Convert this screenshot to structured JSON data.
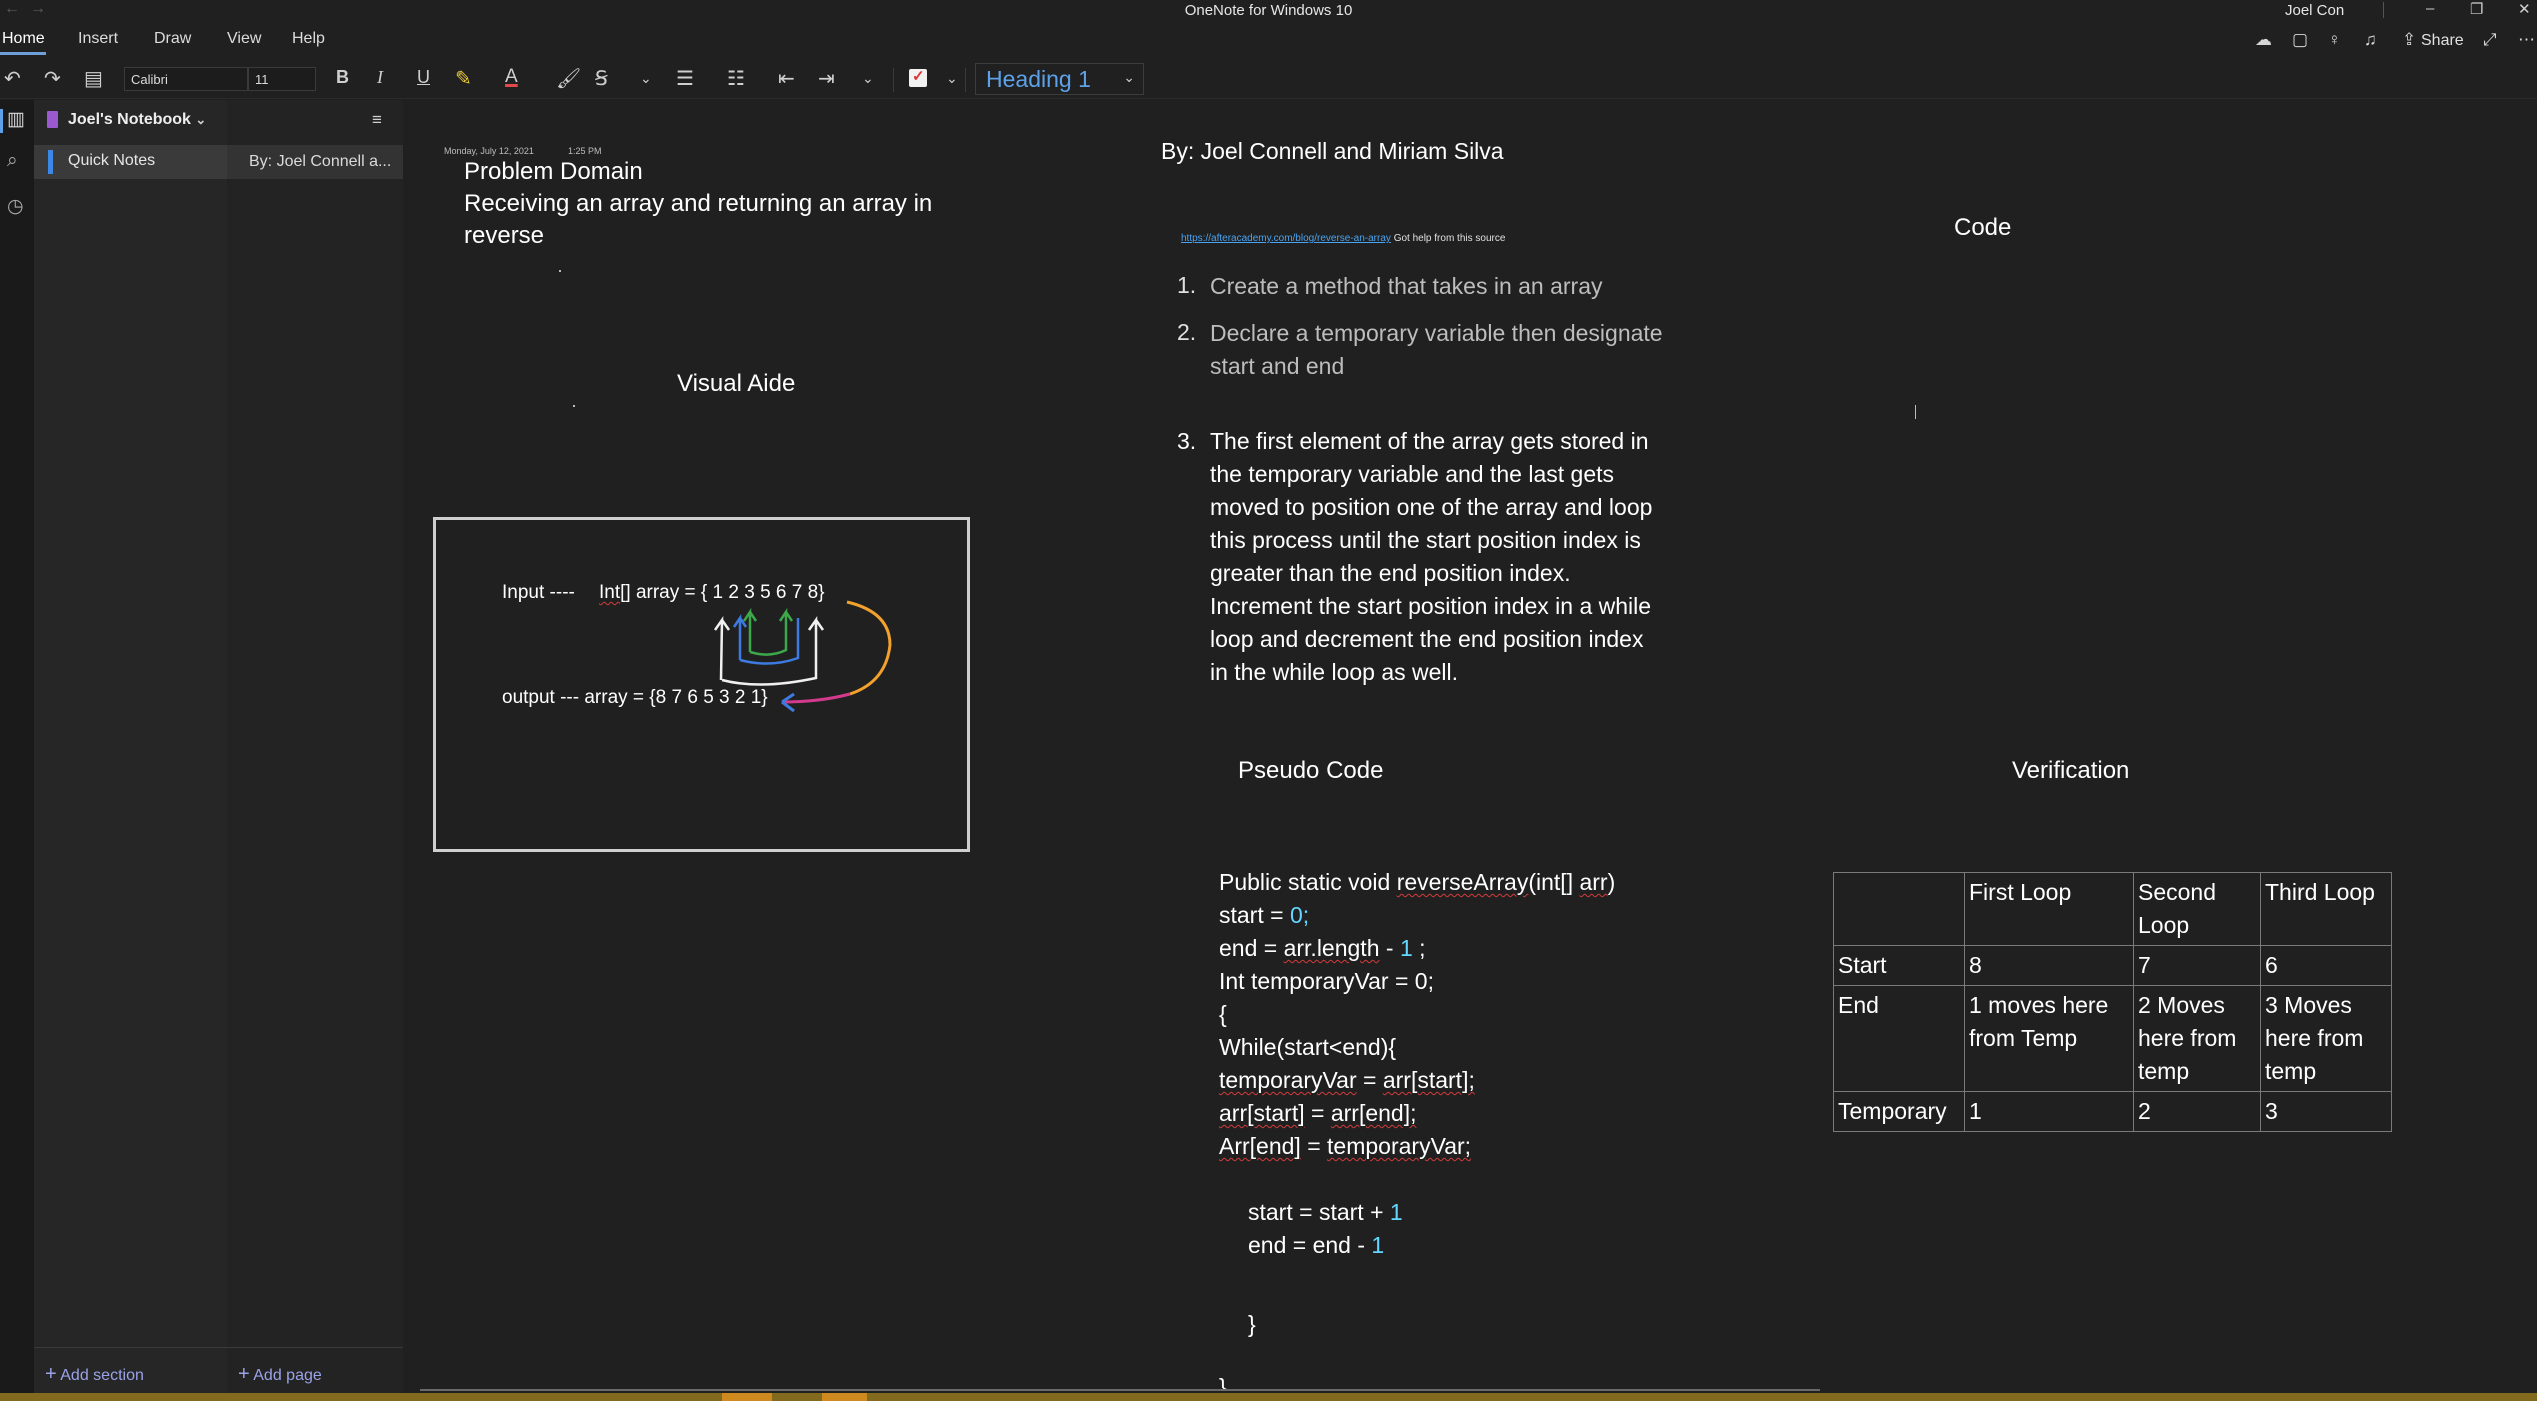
{
  "window": {
    "title": "OneNote for Windows 10",
    "user": "Joel Con",
    "controls": [
      "–",
      "❐",
      "✕"
    ]
  },
  "menu": {
    "tabs": [
      "Home",
      "Insert",
      "Draw",
      "View",
      "Help"
    ],
    "share_label": "Share"
  },
  "toolbar": {
    "font_name": "Calibri",
    "font_size": "11",
    "style_value": "Heading 1",
    "bold": "B",
    "italic": "I",
    "underline": "U"
  },
  "notebook": {
    "title": "Joel's Notebook",
    "section": "Quick Notes",
    "page": "By: Joel Connell a...",
    "add_section": "Add section",
    "add_page": "Add page",
    "section_color": "#9b59d0",
    "section_accent": "#3c88e6"
  },
  "note": {
    "date": "Monday, July 12, 2021",
    "time": "1:25 PM",
    "problem_title": "Problem Domain",
    "problem_text_1": "Receiving an array and returning an array in",
    "problem_text_2": "reverse",
    "visual_aide": "Visual Aide",
    "input_label": "Input ----",
    "input_array_prefix": "Int",
    "input_array_rest": "[] array = { 1 2 3 5 6 7 8}",
    "output_label": "output --- array = {8 7 6 5 3 2 1}",
    "authors": "By: Joel Connell and Miriam Silva",
    "source_link": "https://afteracademy.com/blog/reverse-an-array",
    "source_note": "Got help from this source",
    "code_heading": "Code",
    "steps": [
      {
        "num": "1.",
        "lines": [
          "Create a method that takes in an array"
        ]
      },
      {
        "num": "2.",
        "lines": [
          "Declare a temporary variable then designate",
          "start and end"
        ]
      },
      {
        "num": "3.",
        "lines": [
          "The first element of the array gets stored in",
          "the temporary variable and the last gets",
          "moved to position one of the array and loop",
          "this process until the start position index is",
          "greater than the end position index.",
          "Increment the start position index in a while",
          "loop and decrement the end position index",
          "in the while loop as well."
        ]
      }
    ],
    "pseudo_heading": "Pseudo Code",
    "verification_heading": "Verification",
    "pseudo": {
      "l1_a": "Public static void ",
      "l1_b": "reverseArray",
      "l1_c": "(int[] ",
      "l1_d": "arr",
      "l1_e": ")",
      "l2_a": "start = ",
      "l2_b": "0;",
      "l3_a": "end = ",
      "l3_b": "arr.length",
      "l3_c": " - ",
      "l3_d": "1",
      "l3_e": " ;",
      "l4": "Int temporaryVar = 0;",
      "l5": "{",
      "l6": "While(start<end){",
      "l7_a": "temporaryVar",
      "l7_b": " = ",
      "l7_c": "arr[start];",
      "l8_a": "arr[start]",
      "l8_b": " = ",
      "l8_c": "arr[end];",
      "l9_a": "Arr[end]",
      "l9_b": " = ",
      "l9_c": "temporaryVar;",
      "l10_a": "start = start + ",
      "l10_b": "1",
      "l11_a": "end = end - ",
      "l11_b": "1",
      "l12": "}",
      "l13": "}"
    },
    "table": {
      "header": [
        "",
        "First Loop",
        "Second Loop",
        "Third Loop"
      ],
      "rows": [
        [
          "Start",
          "8",
          "7",
          "6"
        ],
        [
          "End",
          "1  moves here from Temp",
          "2 Moves here from temp",
          "3 Moves here from temp"
        ],
        [
          "Temporary",
          "1",
          "2",
          "3"
        ]
      ]
    },
    "colors": {
      "link": "#4aa3f0",
      "number": "#63d7ff",
      "heading_style": "#5da2e8"
    }
  }
}
